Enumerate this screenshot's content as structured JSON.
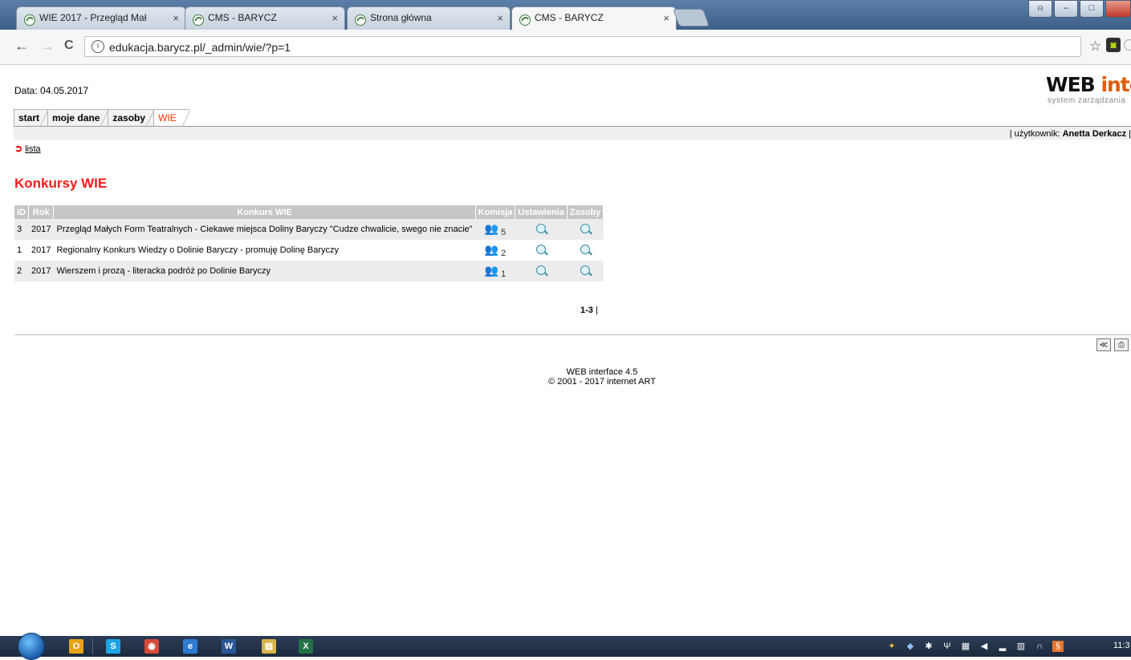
{
  "browser": {
    "tabs": [
      {
        "title": "WIE 2017 - Przegląd Mał",
        "active": false
      },
      {
        "title": "CMS - BARYCZ",
        "active": false
      },
      {
        "title": "Strona główna",
        "active": false
      },
      {
        "title": "CMS - BARYCZ",
        "active": true
      }
    ],
    "close_glyph": "×",
    "url": "edukacja.barycz.pl/_admin/wie/?p=1",
    "back_icon": "←",
    "forward_icon": "→",
    "reload_icon": "C",
    "info_icon": "i",
    "star_icon": "☆",
    "window_buttons": {
      "minimize": "–",
      "maximize": "□",
      "close": ""
    }
  },
  "header": {
    "date_text": "Data: 04.05.2017",
    "logo_main": "WEB",
    "logo_tail": "interf",
    "logo_sub": "system zarządzania"
  },
  "menu": {
    "items": [
      {
        "label": "start"
      },
      {
        "label": "moje dane"
      },
      {
        "label": "zasoby"
      },
      {
        "label": "WIE",
        "active": true
      }
    ]
  },
  "user": {
    "prefix": "| użytkownik: ",
    "name": "Anetta Derkacz",
    "suffix": " |"
  },
  "sub_nav": {
    "arrow": "➲",
    "list_link": "lista"
  },
  "main": {
    "title": "Konkursy WIE",
    "table": {
      "headers": [
        "ID",
        "Rok",
        "Konkurs WIE",
        "Komisja",
        "Ustawienia",
        "Zasoby"
      ],
      "rows": [
        {
          "id": "3",
          "year": "2017",
          "name": "Przegląd Małych Form Teatralnych - Ciekawe miejsca Doliny Baryczy \"Cudze chwalicie, swego nie znacie\"",
          "commission": "5"
        },
        {
          "id": "1",
          "year": "2017",
          "name": "Regionalny Konkurs Wiedzy o Dolinie Baryczy - promuję Dolinę Baryczy",
          "commission": "2"
        },
        {
          "id": "2",
          "year": "2017",
          "name": "Wierszem i prozą - literacka podróż po Dolinie Baryczy",
          "commission": "1"
        }
      ]
    },
    "pager": {
      "range": "1-3",
      "sep": " |"
    }
  },
  "tools": {
    "back": "≪",
    "print": "⎙",
    "mail": "✉"
  },
  "footer": {
    "line1": "WEB interface 4.5",
    "line2": "© 2001 - 2017 internet ART"
  },
  "taskbar": {
    "apps": [
      {
        "name": "outlook",
        "glyph": "O",
        "color": "#e8a317"
      },
      {
        "name": "skype",
        "glyph": "S",
        "color": "#1ea5e6"
      },
      {
        "name": "chrome",
        "glyph": "◉",
        "color": "#d94a38"
      },
      {
        "name": "internet-explorer",
        "glyph": "e",
        "color": "#2e7ad1"
      },
      {
        "name": "word",
        "glyph": "W",
        "color": "#2b5797"
      },
      {
        "name": "explorer",
        "glyph": "▤",
        "color": "#d8b545"
      },
      {
        "name": "excel",
        "glyph": "X",
        "color": "#217346"
      }
    ],
    "clock": "11:3"
  },
  "colors": {
    "accent_red": "#ff1a1a",
    "active_tab_orange": "#ff3300",
    "table_header": "#c6c6c6",
    "row_alt": "#ececec"
  }
}
